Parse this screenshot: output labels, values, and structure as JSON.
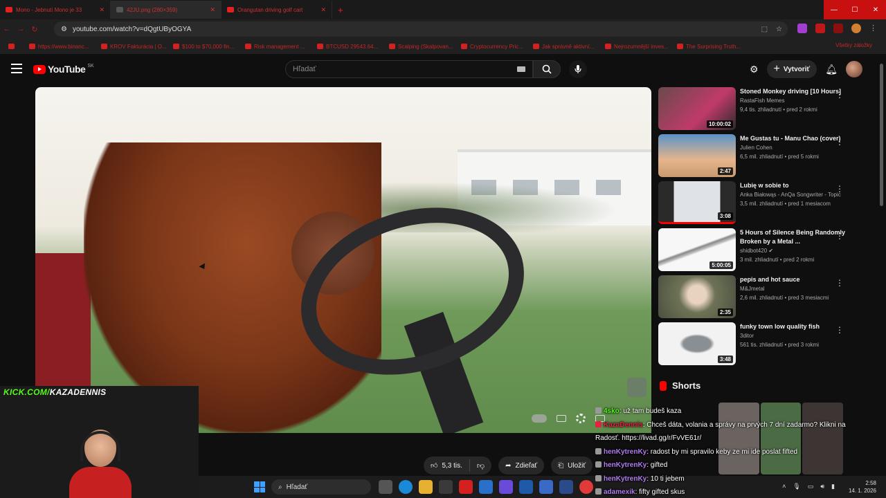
{
  "browser": {
    "tabs": [
      {
        "title": "Mono - Jebnutí Mono je 33"
      },
      {
        "title": "42JU.png (280×359)"
      },
      {
        "title": "Orangutan driving golf cart"
      }
    ],
    "url": "youtube.com/watch?v=dQgtUByOGYA",
    "bookmarks": [
      "https://www.binanc...",
      "KROV Fakturácia | O...",
      "$100 to $70,000 fin...",
      "Risk management ...",
      "BTCUSD 29543.64...",
      "Scalping (Skalpovan...",
      "Cryptocurrency Pric...",
      "Jak správně aktivní...",
      "Nejrozumnější inves...",
      "The Surprising Truth..."
    ],
    "bookmarks_all": "Všetky záložky"
  },
  "youtube": {
    "logo": "YouTube",
    "region": "SK",
    "search_placeholder": "Hľadať",
    "create_label": "Vytvoriť"
  },
  "video_actions": {
    "likes": "5,3 tis.",
    "share": "Zdieľať",
    "save": "Uložiť"
  },
  "recommendations": [
    {
      "title": "Stoned Monkey driving [10 Hours]",
      "channel": "RastaFish Memes",
      "views": "9,4 tis. zhliadnutí • pred 2 rokmi",
      "duration": "10:00:02",
      "color": "#7a5a5a"
    },
    {
      "title": "Me Gustas tu - Manu Chao (cover)",
      "channel": "Julien Cohen",
      "views": "6,5 mil. zhliadnutí • pred 5 rokmi",
      "duration": "2:47",
      "color": "#5b93c6"
    },
    {
      "title": "Lubię w sobie to",
      "channel": "Anka Białowąs - AnQa Songwriter - Topic",
      "views": "3,5 mil. zhliadnutí • pred 1 mesiacom",
      "duration": "3:08",
      "color": "#d5d9de"
    },
    {
      "title": "5 Hours of Silence Being Randomly Broken by a Metal ...",
      "channel": "shidbot420",
      "views": "3 mil. zhliadnutí • pred 2 rokmi",
      "duration": "5:00:05",
      "color": "#f2f2f2"
    },
    {
      "title": "pepis and hot sauce",
      "channel": "M&Jmetal",
      "views": "2,6 mil. zhliadnutí • pred 3 mesiacmi",
      "duration": "2:35",
      "color": "#8a8a6a"
    },
    {
      "title": "funky town low quality fish",
      "channel": "3ditor",
      "views": "561 tis. zhliadnutí • pred 3 rokmi",
      "duration": "3:48",
      "color": "#e8e8e8"
    }
  ],
  "shorts_label": "Shorts",
  "stream": {
    "label_prefix": "KICK.COM/",
    "label_handle": "KAZADENNIS"
  },
  "chat": [
    {
      "user": "4sko",
      "msg": ": už tam budeš kaza",
      "color": "#53fc18"
    },
    {
      "user": "KazaDennis",
      "msg": ": Chceš dáta, volania a správy na prvých 7 dní zadarmo? Klikni na",
      "color": "#e52040"
    },
    {
      "user": "",
      "msg": "Radosť. https://livad.gg/r/FvVE61r/",
      "color": "#ffffff"
    },
    {
      "user": "henKytrenKy",
      "msg": ": radost by mi spravilo keby ze mi ide poslat fifted",
      "color": "#b07cf0"
    },
    {
      "user": "henKytrenKy",
      "msg": ": gifted",
      "color": "#b07cf0"
    },
    {
      "user": "henKytrenKy",
      "msg": ": 10 ti jebem",
      "color": "#b07cf0"
    },
    {
      "user": "adamexik",
      "msg": ": fifty gifted skus",
      "color": "#b07cf0"
    }
  ],
  "taskbar": {
    "search": "Hľadať",
    "time": "2:58",
    "date": "14. 1. 2026"
  }
}
